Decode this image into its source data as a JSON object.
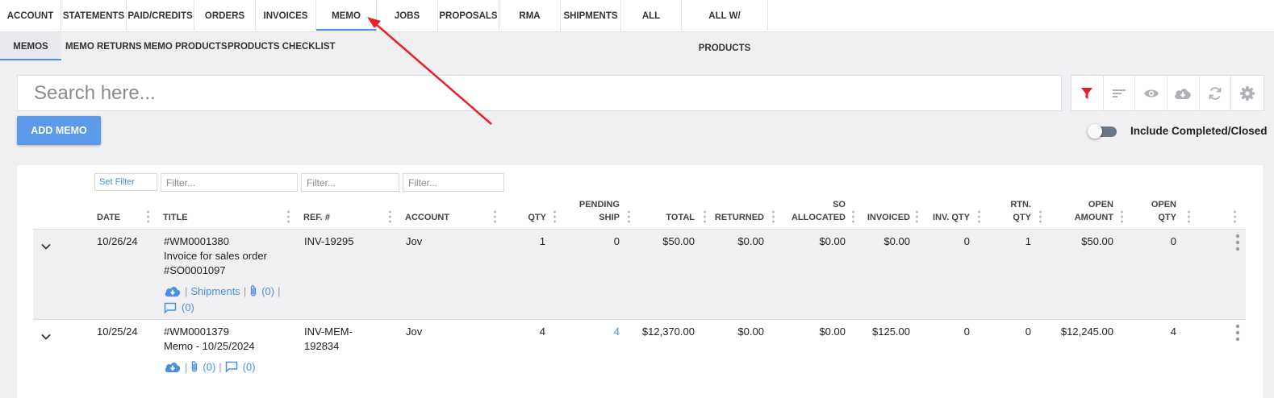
{
  "colors": {
    "accent": "#4a90e2",
    "filter_active": "#e8192c",
    "button_bg": "#5b9bea",
    "annotation_arrow": "#e8202a"
  },
  "top_tabs": [
    {
      "label": "ACCOUNT"
    },
    {
      "label": "STATEMENTS"
    },
    {
      "label": "PAID/CREDITS"
    },
    {
      "label": "ORDERS"
    },
    {
      "label": "INVOICES"
    },
    {
      "label": "MEMO",
      "active": true
    },
    {
      "label": "JOBS"
    },
    {
      "label": "PROPOSALS"
    },
    {
      "label": "RMA"
    },
    {
      "label": "SHIPMENTS"
    },
    {
      "label": "ALL"
    },
    {
      "label": "ALL W/ PRODUCTS"
    }
  ],
  "sub_tabs": [
    {
      "label": "MEMOS",
      "active": true
    },
    {
      "label": "MEMO RETURNS"
    },
    {
      "label": "MEMO PRODUCTS"
    },
    {
      "label": "PRODUCTS CHECKLIST"
    }
  ],
  "search": {
    "placeholder": "Search here..."
  },
  "toolbar": {
    "icons": [
      "filter-icon",
      "sort-icon",
      "eye-icon",
      "cloud-download-icon",
      "refresh-icon",
      "gear-icon"
    ]
  },
  "add_button": {
    "label": "ADD MEMO"
  },
  "toggle": {
    "label": "Include Completed/Closed",
    "on": false
  },
  "filters": {
    "set_filter": "Set Filter",
    "placeholder": "Filter..."
  },
  "columns": {
    "date": "DATE",
    "title": "TITLE",
    "ref": "REF. #",
    "account": "ACCOUNT",
    "qty": "QTY",
    "pending_ship_1": "PENDING",
    "pending_ship_2": "SHIP",
    "total": "TOTAL",
    "returned": "RETURNED",
    "so_allocated_1": "SO",
    "so_allocated_2": "ALLOCATED",
    "invoiced": "INVOICED",
    "inv_qty": "INV. QTY",
    "rtn_qty_1": "RTN.",
    "rtn_qty_2": "QTY",
    "open_amount_1": "OPEN",
    "open_amount_2": "AMOUNT",
    "open_qty_1": "OPEN",
    "open_qty_2": "QTY"
  },
  "rows": [
    {
      "date": "10/26/24",
      "title_1": "#WM0001380",
      "title_2": "Invoice for sales order",
      "title_3": "#SO0001097",
      "ref_1": "INV-19295",
      "account": "Jov",
      "qty": "1",
      "pending_ship": "0",
      "total": "$50.00",
      "returned": "$0.00",
      "so_allocated": "$0.00",
      "invoiced": "$0.00",
      "inv_qty": "0",
      "rtn_qty": "1",
      "open_amount": "$50.00",
      "open_qty": "0",
      "shipments_label": "Shipments",
      "attachments": "(0)",
      "comments": "(0)"
    },
    {
      "date": "10/25/24",
      "title_1": "#WM0001379",
      "title_2": "Memo - 10/25/2024",
      "ref_1": "INV-MEM-",
      "ref_2": "192834",
      "account": "Jov",
      "qty": "4",
      "pending_ship": "4",
      "total": "$12,370.00",
      "returned": "$0.00",
      "so_allocated": "$0.00",
      "invoiced": "$125.00",
      "inv_qty": "0",
      "rtn_qty": "0",
      "open_amount": "$12,245.00",
      "open_qty": "4",
      "attachments": "(0)",
      "comments": "(0)"
    }
  ]
}
